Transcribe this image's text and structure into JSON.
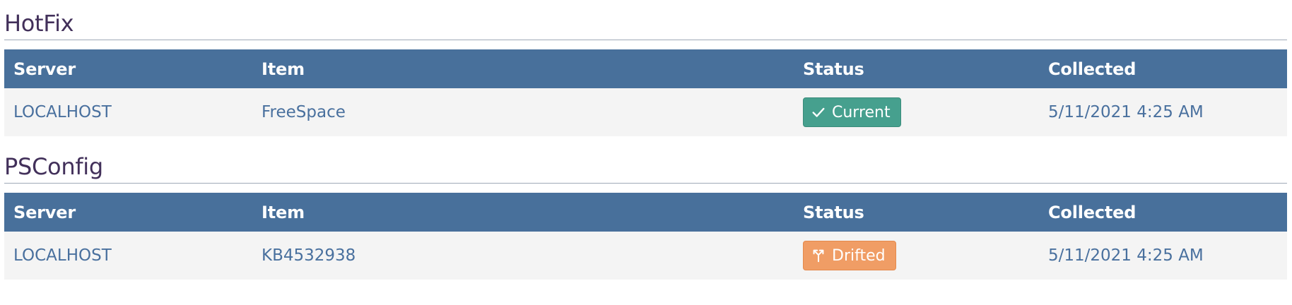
{
  "sections": [
    {
      "title": "HotFix",
      "columns": [
        "Server",
        "Item",
        "Status",
        "Collected"
      ],
      "rows": [
        {
          "server": "LOCALHOST",
          "item": "FreeSpace",
          "status": "Current",
          "status_icon": "check-icon",
          "status_color": "#46a08e",
          "collected": "5/11/2021 4:25 AM"
        }
      ]
    },
    {
      "title": "PSConfig",
      "columns": [
        "Server",
        "Item",
        "Status",
        "Collected"
      ],
      "rows": [
        {
          "server": "LOCALHOST",
          "item": "KB4532938",
          "status": "Drifted",
          "status_icon": "branch-icon",
          "status_color": "#f09d65",
          "collected": "5/11/2021 4:25 AM"
        }
      ]
    }
  ],
  "colors": {
    "header_bg": "#48709b",
    "row_bg": "#f4f4f4",
    "title_color": "#42305a",
    "cell_text": "#49709e"
  }
}
